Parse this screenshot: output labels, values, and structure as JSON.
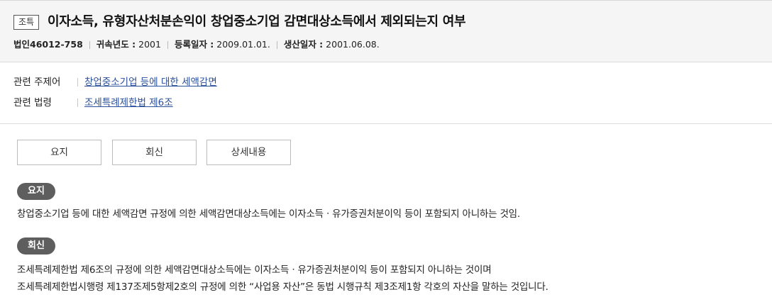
{
  "header": {
    "tag": "조특",
    "title": "이자소득, 유형자산처분손익이 창업중소기업 감면대상소득에서 제외되는지 여부",
    "meta": {
      "doc_id": "법인46012-758",
      "year_label": "귀속년도 :",
      "year_value": "2001",
      "reg_label": "등록일자 :",
      "reg_value": "2009.01.01.",
      "prod_label": "생산일자 :",
      "prod_value": "2001.06.08."
    }
  },
  "related": {
    "topic_label": "관련 주제어",
    "topic_value": "창업중소기업 등에 대한 세액감면",
    "law_label": "관련 법령",
    "law_value": "조세특례제한법 제6조"
  },
  "tabs": [
    "요지",
    "회신",
    "상세내용"
  ],
  "summary": {
    "label": "요지",
    "text": "창업중소기업 등에 대한 세액감면 규정에 의한 세액감면대상소득에는 이자소득ㆍ유가증권처분이익 등이 포함되지 아니하는 것임."
  },
  "reply": {
    "label": "회신",
    "line1": "조세특례제한법 제6조의 규정에 의한 세액감면대상소득에는 이자소득ㆍ유가증권처분이익 등이 포함되지 아니하는 것이며",
    "line2": "조세특례제한법시행령 제137조제5항제2호의 규정에 의한 “사업용 자산”은 동법 시행규칙 제3조제1항 각호의 자산을 말하는 것입니다."
  }
}
